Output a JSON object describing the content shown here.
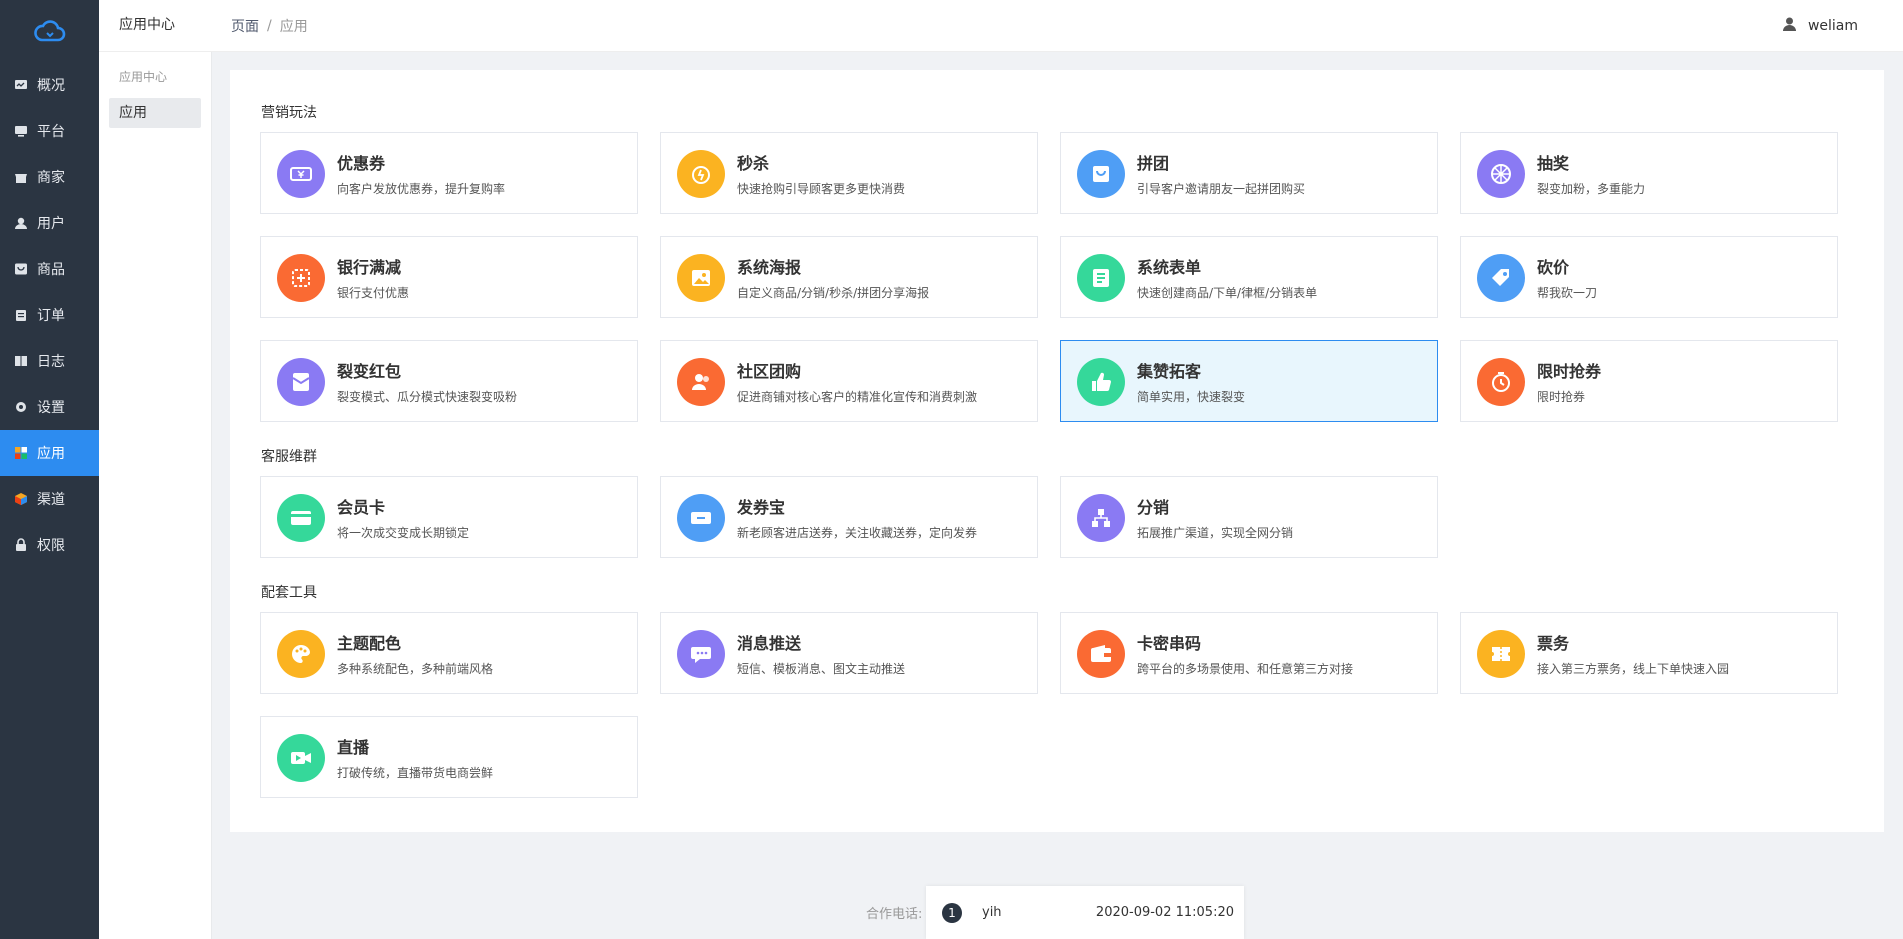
{
  "sidebar": {
    "items": [
      {
        "label": "概况",
        "icon": "dashboard-icon"
      },
      {
        "label": "平台",
        "icon": "monitor-icon"
      },
      {
        "label": "商家",
        "icon": "store-icon"
      },
      {
        "label": "用户",
        "icon": "user-icon"
      },
      {
        "label": "商品",
        "icon": "goods-icon"
      },
      {
        "label": "订单",
        "icon": "clipboard-icon"
      },
      {
        "label": "日志",
        "icon": "book-icon"
      },
      {
        "label": "设置",
        "icon": "gear-icon"
      },
      {
        "label": "应用",
        "icon": "apps-icon"
      },
      {
        "label": "渠道",
        "icon": "cube-icon"
      },
      {
        "label": "权限",
        "icon": "lock-icon"
      }
    ],
    "active_index": 8
  },
  "subnav": {
    "title": "应用中心",
    "group": "应用中心",
    "item": "应用"
  },
  "header": {
    "crumb_root": "页面",
    "crumb_sep": "/",
    "crumb_current": "应用",
    "username": "weliam"
  },
  "sections": [
    {
      "title": "营销玩法"
    },
    {
      "title": "客服维群"
    },
    {
      "title": "配套工具"
    }
  ],
  "apps": [
    {
      "title": "优惠券",
      "desc": "向客户发放优惠券，提升复购率",
      "color": "#8a7af3",
      "icon": "coupon-icon"
    },
    {
      "title": "秒杀",
      "desc": "快速抢购引导顾客更多更快消费",
      "color": "#fbb321",
      "icon": "alarm-icon"
    },
    {
      "title": "拼团",
      "desc": "引导客户邀请朋友一起拼团购买",
      "color": "#4f9ef5",
      "icon": "bag-icon"
    },
    {
      "title": "抽奖",
      "desc": "裂变加粉，多重能力",
      "color": "#8a7af3",
      "icon": "wheel-icon"
    },
    {
      "title": "银行满减",
      "desc": "银行支付优惠",
      "color": "#fa6a33",
      "icon": "discount-icon"
    },
    {
      "title": "系统海报",
      "desc": "自定义商品/分销/秒杀/拼团分享海报",
      "color": "#fbb321",
      "icon": "image-icon"
    },
    {
      "title": "系统表单",
      "desc": "快速创建商品/下单/律框/分销表单",
      "color": "#35d89a",
      "icon": "form-icon"
    },
    {
      "title": "砍价",
      "desc": "帮我砍一刀",
      "color": "#4f9ef5",
      "icon": "tag-icon"
    },
    {
      "title": "裂变红包",
      "desc": "裂变模式、瓜分模式快速裂变吸粉",
      "color": "#8a7af3",
      "icon": "redpacket-icon"
    },
    {
      "title": "社区团购",
      "desc": "促进商铺对核心客户的精准化宣传和消费刺激",
      "color": "#fa6a33",
      "icon": "group-icon"
    },
    {
      "title": "集赞拓客",
      "desc": "简单实用，快速裂变",
      "color": "#35d89a",
      "icon": "thumbs-up-icon"
    },
    {
      "title": "限时抢券",
      "desc": "限时抢券",
      "color": "#fa6a33",
      "icon": "stopwatch-icon"
    },
    {
      "title": "会员卡",
      "desc": "将一次成交变成长期锁定",
      "color": "#35d89a",
      "icon": "card-icon"
    },
    {
      "title": "发券宝",
      "desc": "新老顾客进店送券，关注收藏送券，定向发券",
      "color": "#4f9ef5",
      "icon": "ticket-icon"
    },
    {
      "title": "分销",
      "desc": "拓展推广渠道，实现全网分销",
      "color": "#8a7af3",
      "icon": "distribution-icon"
    },
    {
      "title": "主题配色",
      "desc": "多种系统配色，多种前端风格",
      "color": "#fbb321",
      "icon": "palette-icon"
    },
    {
      "title": "消息推送",
      "desc": "短信、模板消息、图文主动推送",
      "color": "#8a7af3",
      "icon": "message-icon"
    },
    {
      "title": "卡密串码",
      "desc": "跨平台的多场景使用、和任意第三方对接",
      "color": "#fa6a33",
      "icon": "wallet-icon"
    },
    {
      "title": "票务",
      "desc": "接入第三方票务，线上下单快速入园",
      "color": "#fbb321",
      "icon": "ticket-stub-icon"
    },
    {
      "title": "直播",
      "desc": "打破传统，直播带货电商尝鲜",
      "color": "#35d89a",
      "icon": "video-icon"
    }
  ],
  "selected_app_index": 10,
  "footer": {
    "label": "合作电话:",
    "badge": "1",
    "name": "yih",
    "time": "2020-09-02 11:05:20"
  }
}
